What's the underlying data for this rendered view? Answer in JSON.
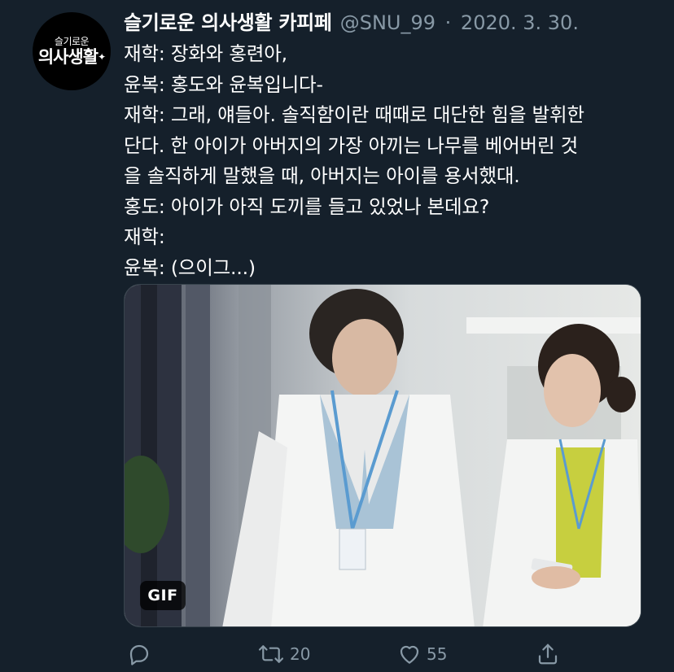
{
  "author": {
    "display_name": "슬기로운 의사생활 카피페",
    "handle": "@SNU_99",
    "separator": "·",
    "date": "2020. 3. 30."
  },
  "avatar": {
    "line1": "슬기로운",
    "line2": "의사생활"
  },
  "tweet": {
    "lines": [
      "재학: 장화와 홍련아,",
      "윤복: 홍도와 윤복입니다-",
      "재학: 그래, 얘들아. 솔직함이란 때때로 대단한 힘을 발휘한",
      "단다. 한 아이가 아버지의 가장 아끼는 나무를 베어버린 것",
      "을 솔직하게 말했을 때, 아버지는 아이를 용서했대.",
      "홍도: 아이가 아직 도끼를 들고 있었나 본데요?",
      "재학:",
      "윤복: (으이그...)"
    ]
  },
  "media": {
    "badge": "GIF"
  },
  "actions": {
    "reply_icon": "reply-icon",
    "retweet_icon": "retweet-icon",
    "retweet_count": "20",
    "like_icon": "heart-icon",
    "like_count": "55",
    "share_icon": "share-icon"
  },
  "colors": {
    "background": "#15202b",
    "primary_text": "#ffffff",
    "secondary_text": "#8899a6"
  }
}
